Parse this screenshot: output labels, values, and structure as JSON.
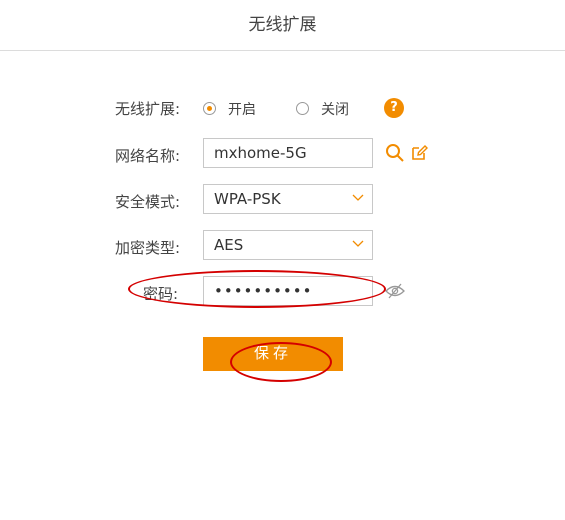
{
  "header": {
    "title": "无线扩展"
  },
  "form": {
    "wireless_extend": {
      "label": "无线扩展:",
      "options": [
        {
          "label": "开启",
          "selected": true
        },
        {
          "label": "关闭",
          "selected": false
        }
      ],
      "help": "?"
    },
    "network_name": {
      "label": "网络名称:",
      "value": "mxhome-5G"
    },
    "security_mode": {
      "label": "安全模式:",
      "value": "WPA-PSK"
    },
    "encryption_type": {
      "label": "加密类型:",
      "value": "AES"
    },
    "password": {
      "label": "密码:",
      "value": "••••••••••"
    }
  },
  "actions": {
    "save_label": "保存"
  },
  "colors": {
    "accent": "#f28c00",
    "annotation": "#d40000",
    "border": "#c8c8c8"
  }
}
